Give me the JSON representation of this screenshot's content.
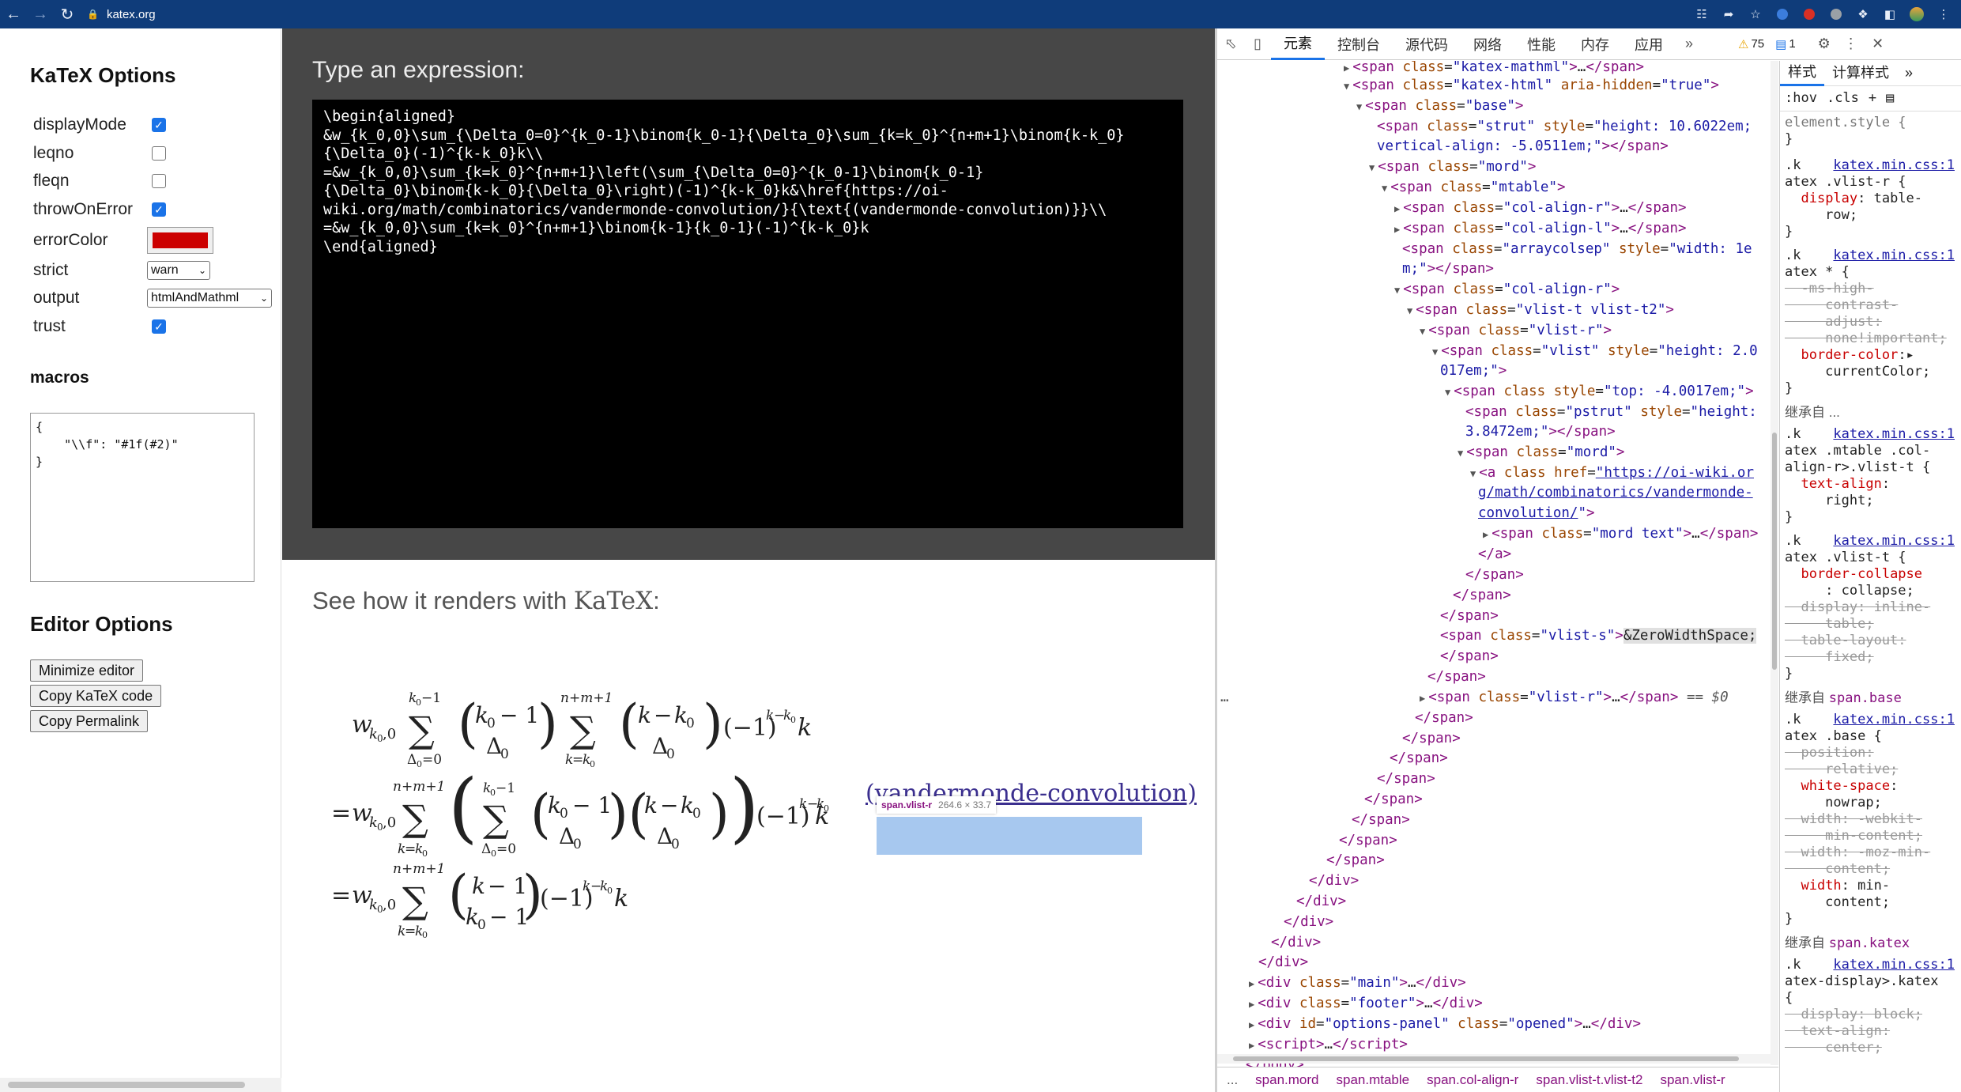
{
  "browser": {
    "url": "katex.org",
    "back_icon": "arrow-left-icon",
    "forward_icon": "arrow-right-icon",
    "reload_icon": "reload-icon"
  },
  "options_panel": {
    "title": "KaTeX Options",
    "options": [
      {
        "label": "displayMode",
        "checked": true
      },
      {
        "label": "leqno",
        "checked": false
      },
      {
        "label": "fleqn",
        "checked": false
      },
      {
        "label": "throwOnError",
        "checked": true
      }
    ],
    "error_color_label": "errorColor",
    "error_color": "#cc0000",
    "strict_label": "strict",
    "strict_value": "warn",
    "output_label": "output",
    "output_value": "htmlAndMathml",
    "trust_label": "trust",
    "trust_checked": true,
    "macros_title": "macros",
    "macros_text": "{\n    \"\\\\f\": \"#1f(#2)\"\n}",
    "editor_title": "Editor Options",
    "buttons": [
      "Minimize editor",
      "Copy KaTeX code",
      "Copy Permalink"
    ]
  },
  "editor": {
    "label": "Type an expression:",
    "code": "\\begin{aligned}\n&w_{k_0,0}\\sum_{\\Delta_0=0}^{k_0-1}\\binom{k_0-1}{\\Delta_0}\\sum_{k=k_0}^{n+m+1}\\binom{k-k_0}\n{\\Delta_0}(-1)^{k-k_0}k\\\\\n=&w_{k_0,0}\\sum_{k=k_0}^{n+m+1}\\left(\\sum_{\\Delta_0=0}^{k_0-1}\\binom{k_0-1}\n{\\Delta_0}\\binom{k-k_0}{\\Delta_0}\\right)(-1)^{k-k_0}k&\\href{https://oi-\nwiki.org/math/combinatorics/vandermonde-convolution/}{\\text{(vandermonde-convolution)}}\\\\\n=&w_{k_0,0}\\sum_{k=k_0}^{n+m+1}\\binom{k-1}{k_0-1}(-1)^{k-k_0}k\n\\end{aligned}"
  },
  "render": {
    "label_prefix": "See how it renders with ",
    "label_logo": "KaTeX",
    "label_suffix": ":",
    "link_text": "(vandermonde-convolution)",
    "highlight_tag": "span.vlist-r",
    "highlight_size": "264.6 × 33.7"
  },
  "devtools": {
    "tabs": [
      "元素",
      "控制台",
      "源代码",
      "网络",
      "性能",
      "内存",
      "应用"
    ],
    "active_tab": "元素",
    "warnings": "75",
    "messages": "1",
    "styles_tabs": [
      "样式",
      "计算样式"
    ],
    "styles_filter": [
      ":hov",
      ".cls",
      "+"
    ],
    "breadcrumbs": [
      "...",
      "span.mord",
      "span.mtable",
      "span.col-align-r",
      "span.vlist-t.vlist-t2",
      "span.vlist-r"
    ]
  }
}
